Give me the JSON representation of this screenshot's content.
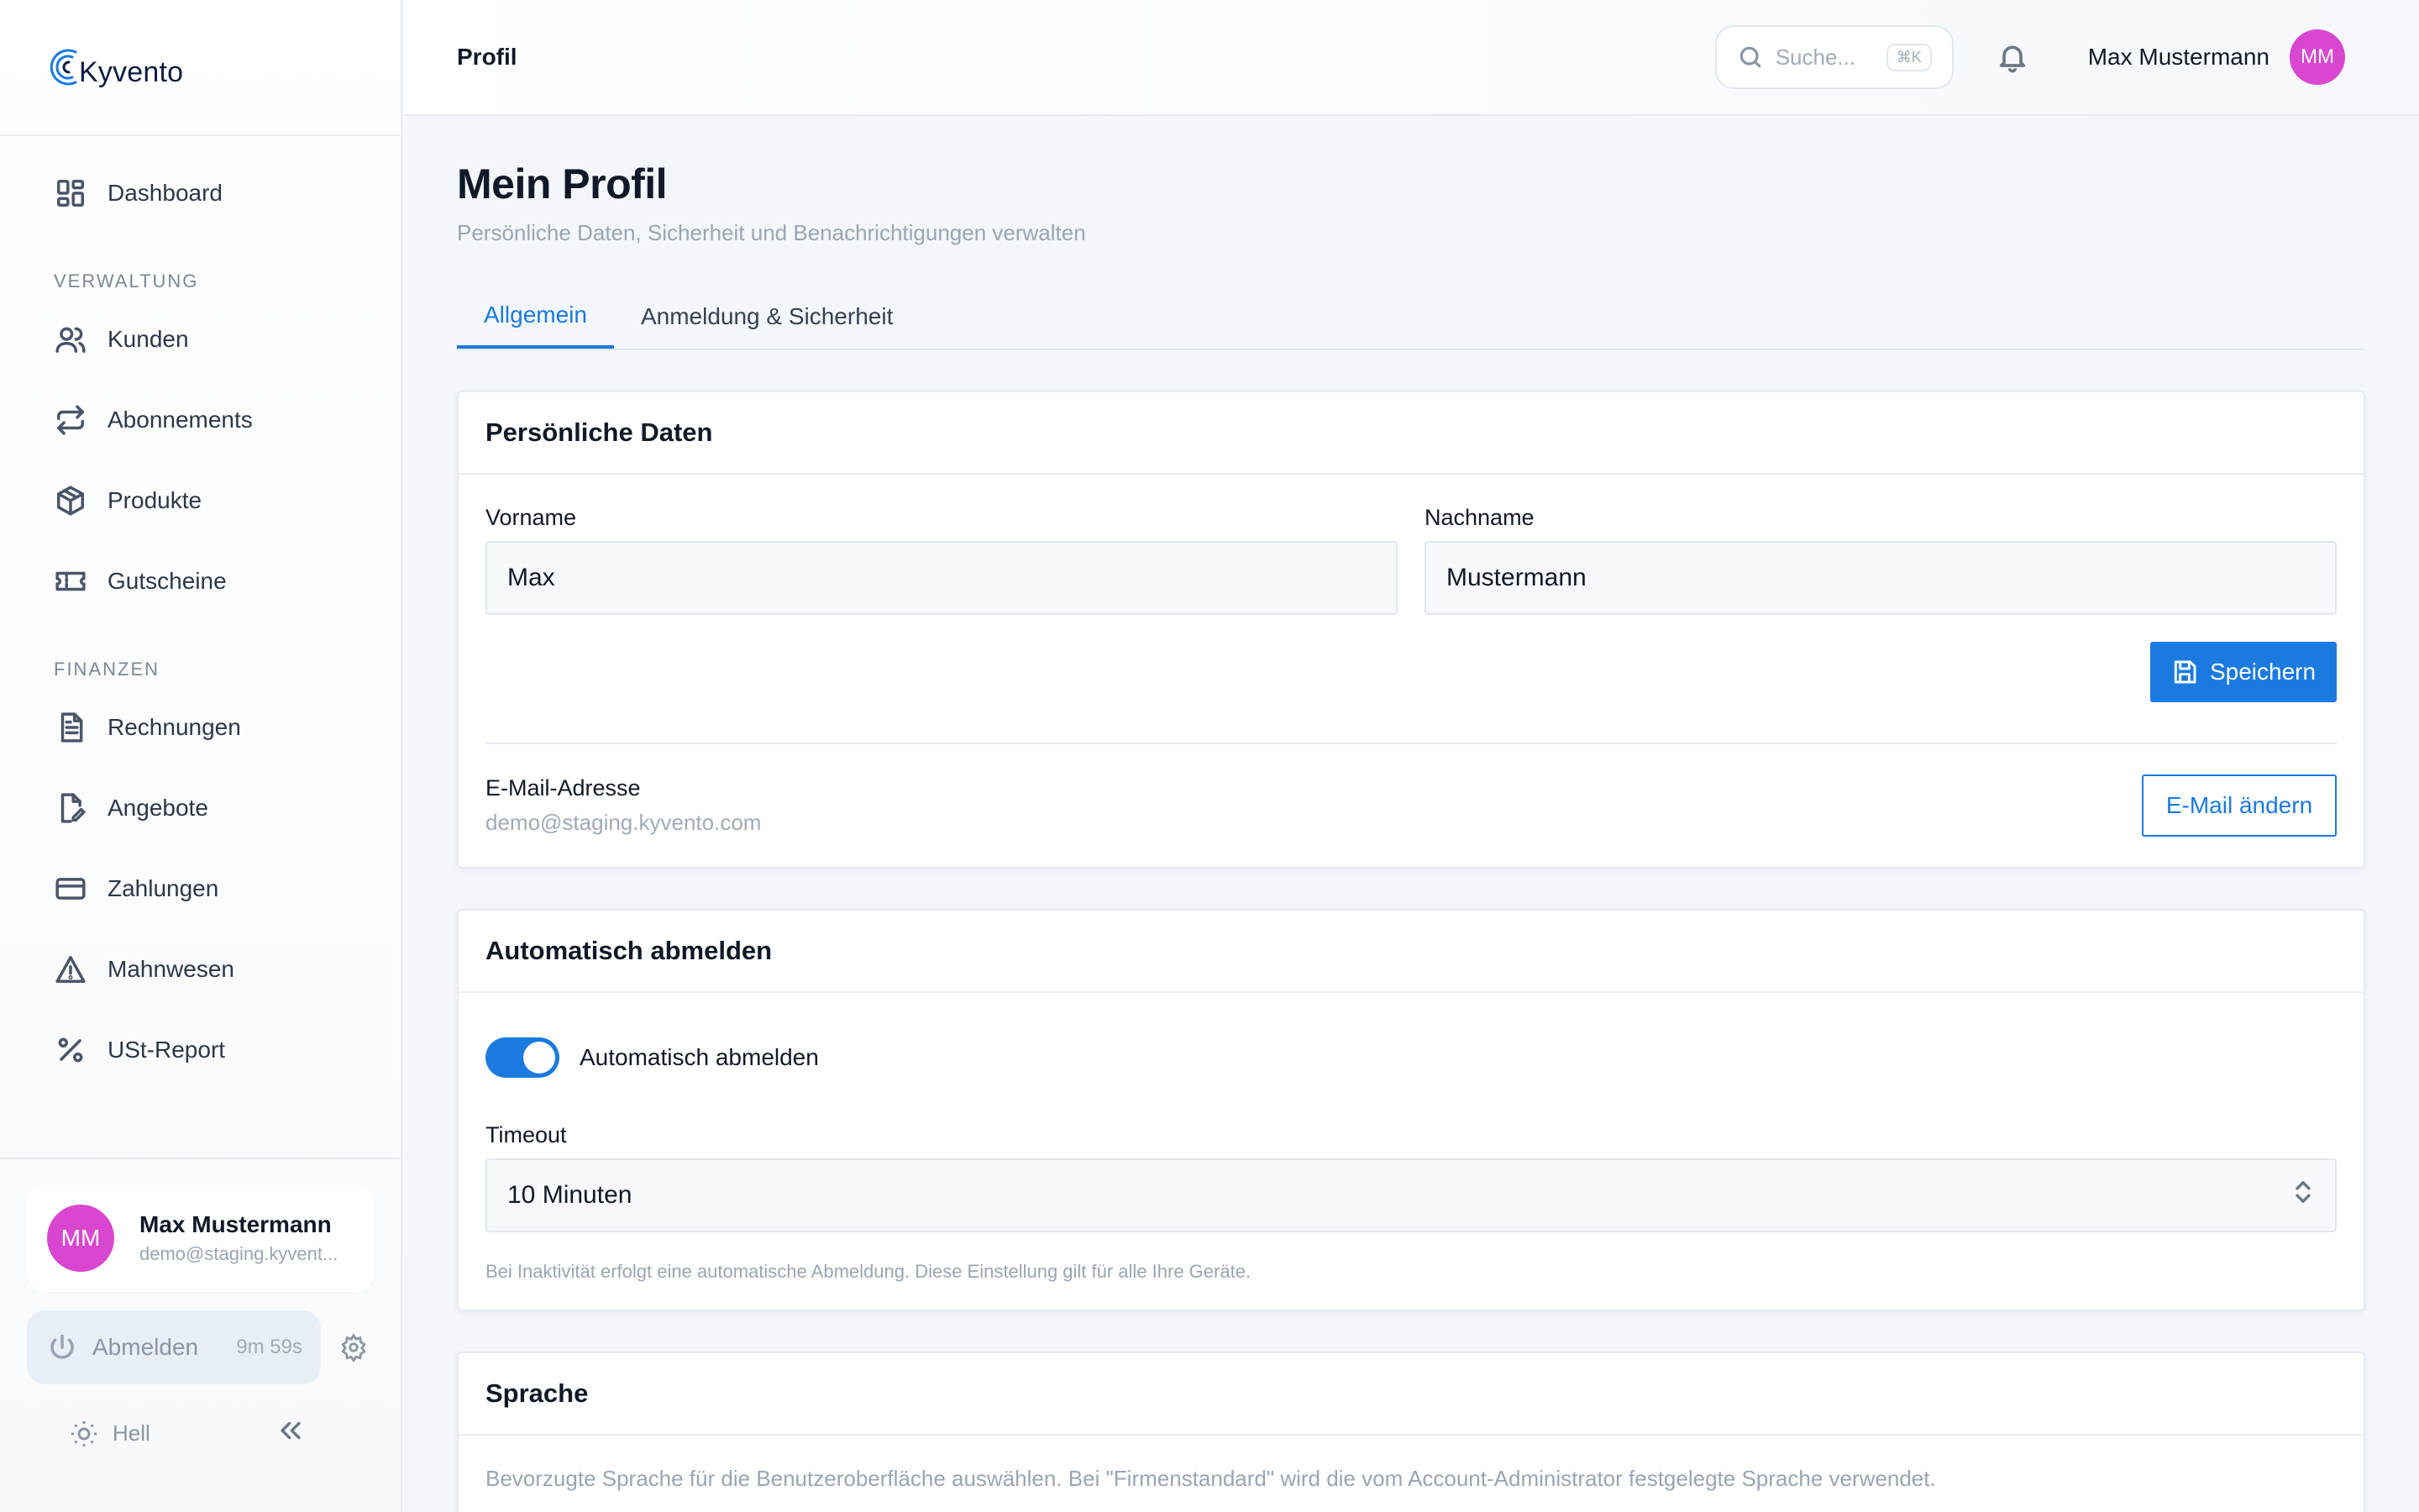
{
  "brand": {
    "name": "Kyvento"
  },
  "sidebar": {
    "items": [
      {
        "label": "Dashboard",
        "icon": "dashboard-icon"
      }
    ],
    "sections": [
      {
        "title": "VERWALTUNG",
        "items": [
          {
            "label": "Kunden",
            "icon": "users-icon"
          },
          {
            "label": "Abonnements",
            "icon": "repeat-icon"
          },
          {
            "label": "Produkte",
            "icon": "box-icon"
          },
          {
            "label": "Gutscheine",
            "icon": "ticket-icon"
          }
        ]
      },
      {
        "title": "FINANZEN",
        "items": [
          {
            "label": "Rechnungen",
            "icon": "document-icon"
          },
          {
            "label": "Angebote",
            "icon": "edit-document-icon"
          },
          {
            "label": "Zahlungen",
            "icon": "credit-card-icon"
          },
          {
            "label": "Mahnwesen",
            "icon": "warning-icon"
          },
          {
            "label": "USt-Report",
            "icon": "percent-icon"
          }
        ]
      }
    ],
    "user": {
      "initials": "MM",
      "name": "Max Mustermann",
      "email": "demo@staging.kyvent..."
    },
    "logout": {
      "label": "Abmelden",
      "timer": "9m 59s"
    },
    "theme": {
      "label": "Hell"
    }
  },
  "header": {
    "breadcrumb": "Profil",
    "search": {
      "placeholder": "Suche...",
      "shortcut": "⌘K"
    },
    "user": {
      "name": "Max Mustermann",
      "initials": "MM"
    }
  },
  "page": {
    "title": "Mein Profil",
    "subtitle": "Persönliche Daten, Sicherheit und Benachrichtigungen verwalten",
    "tabs": [
      {
        "label": "Allgemein",
        "active": true
      },
      {
        "label": "Anmeldung & Sicherheit",
        "active": false
      }
    ]
  },
  "personal": {
    "title": "Persönliche Daten",
    "first_name_label": "Vorname",
    "first_name_value": "Max",
    "last_name_label": "Nachname",
    "last_name_value": "Mustermann",
    "save_label": "Speichern",
    "email_label": "E-Mail-Adresse",
    "email_value": "demo@staging.kyvento.com",
    "change_email_label": "E-Mail ändern"
  },
  "autologout": {
    "title": "Automatisch abmelden",
    "toggle_label": "Automatisch abmelden",
    "toggle_on": true,
    "timeout_label": "Timeout",
    "timeout_value": "10 Minuten",
    "hint": "Bei Inaktivität erfolgt eine automatische Abmeldung. Diese Einstellung gilt für alle Ihre Geräte."
  },
  "language": {
    "title": "Sprache",
    "description": "Bevorzugte Sprache für die Benutzeroberfläche auswählen. Bei \"Firmenstandard\" wird die vom Account-Administrator festgelegte Sprache verwendet."
  },
  "colors": {
    "accent": "#1a7ae0",
    "avatar": "#d946d0"
  }
}
